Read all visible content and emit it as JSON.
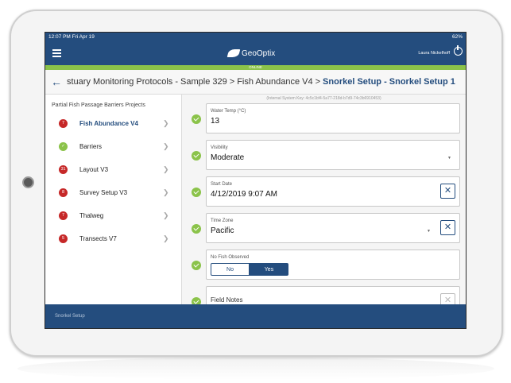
{
  "status_bar": {
    "time": "12:07 PM  Fri Apr 19",
    "indicators": "62%"
  },
  "nav": {
    "logo": "GeoOptix",
    "user": "Laura Nickelhoff"
  },
  "online_label": "ONLINE",
  "breadcrumb": {
    "items": [
      "stuary Monitoring Protocols - Sample 329",
      "Fish Abundance V4",
      "Snorkel Setup - Snorkel Setup 1"
    ],
    "separator": ">"
  },
  "sidebar": {
    "title": "Partial Fish Passage Barriers Projects",
    "items": [
      {
        "label": "Fish Abundance V4",
        "badge": "7"
      },
      {
        "label": "Barriers",
        "badge": ""
      },
      {
        "label": "Layout V3",
        "badge": "31"
      },
      {
        "label": "Survey Setup V3",
        "badge": "8"
      },
      {
        "label": "Thalweg",
        "badge": "7"
      },
      {
        "label": "Transects V7",
        "badge": "5"
      }
    ]
  },
  "form": {
    "system_key": "(Internal System Key: 4c5c1bf4-5a77-218d-b7d9-74c3b6910453)",
    "water_temp": {
      "label": "Water Temp (°C)",
      "value": "13"
    },
    "visibility": {
      "label": "Visibility",
      "value": "Moderate"
    },
    "start_date": {
      "label": "Start Date",
      "value": "4/12/2019 9:07 AM"
    },
    "time_zone": {
      "label": "Time Zone",
      "value": "Pacific"
    },
    "no_fish": {
      "label": "No Fish Observed",
      "no": "No",
      "yes": "Yes"
    },
    "field_notes": {
      "label": "Field Notes"
    }
  },
  "footer": {
    "label": "Snorkel Setup"
  },
  "colors": {
    "brand": "#244d7e",
    "ok": "#8bc34a",
    "alert": "#c62828"
  }
}
